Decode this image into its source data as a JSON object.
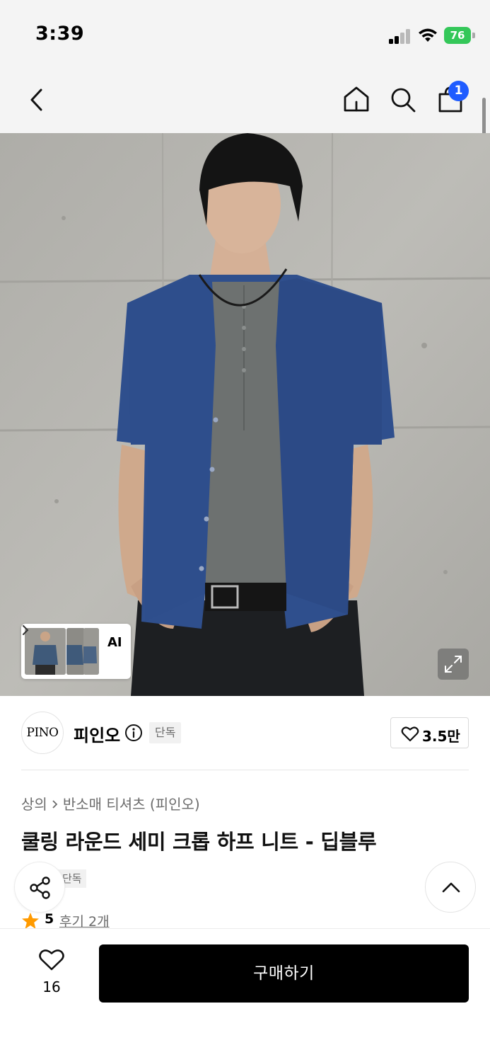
{
  "status_bar": {
    "time": "3:39",
    "battery_level": "76",
    "battery_color": "#34c759"
  },
  "nav": {
    "back_icon": "chevron-left-icon",
    "home_icon": "home-icon",
    "search_icon": "search-icon",
    "cart_icon": "shopping-bag-icon",
    "cart_badge": "1",
    "badge_color": "#1f5cff"
  },
  "hero": {
    "thumbnail_label": "AI",
    "expand_icon": "expand-icon"
  },
  "brand": {
    "logo_text": "PINO",
    "name": "피인오",
    "info_icon": "info-icon",
    "tag": "단독",
    "likes": "3.5만"
  },
  "product": {
    "breadcrumb": [
      "상의",
      "반소매 티셔츠 (피인오)"
    ],
    "title": "쿨링 라운드 세미 크롭 하프 니트 - 딥블루",
    "tags": [
      "단독"
    ],
    "rating": "5",
    "reviews": "후기 2개"
  },
  "floating": {
    "share_icon": "share-icon",
    "scroll_top_icon": "chevron-up-icon"
  },
  "bottom_bar": {
    "wishlist_count": "16",
    "buy_label": "구매하기",
    "buy_color": "#000000"
  }
}
